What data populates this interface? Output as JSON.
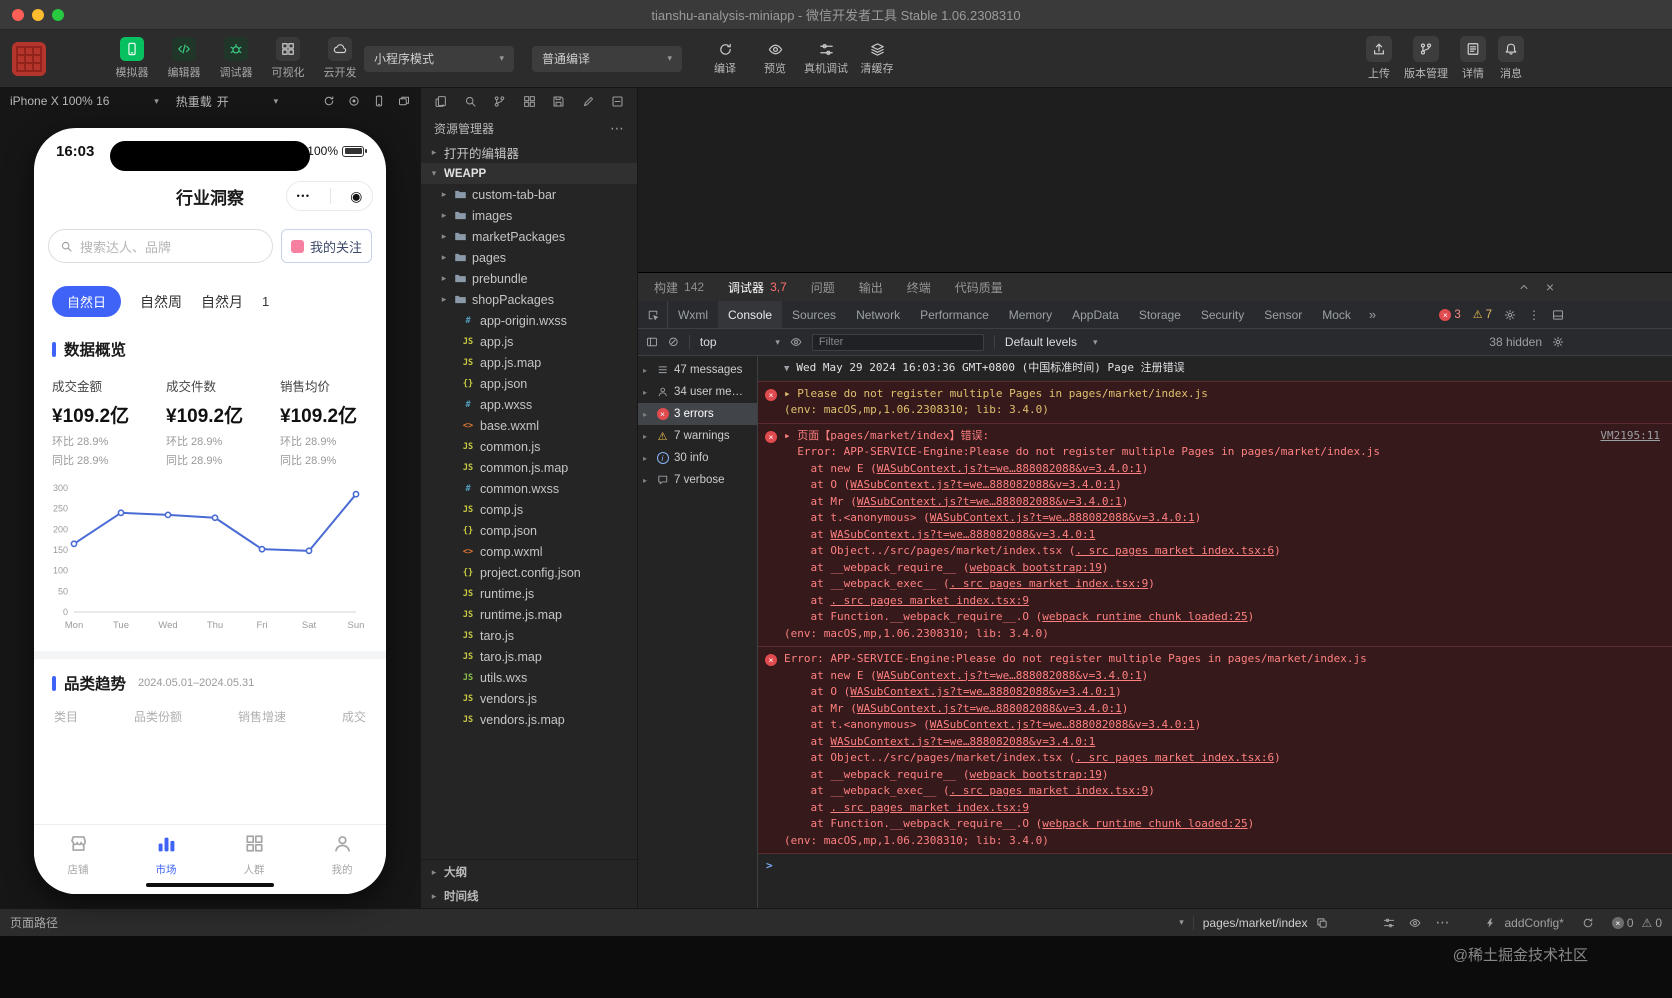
{
  "titlebar": {
    "title": "tianshu-analysis-miniapp - 微信开发者工具 Stable 1.06.2308310"
  },
  "toolbar": {
    "mode_buttons": [
      {
        "label": "模拟器",
        "icon": "simulator-icon",
        "style": "green-fill"
      },
      {
        "label": "编辑器",
        "icon": "editor-icon",
        "style": "green"
      },
      {
        "label": "调试器",
        "icon": "debugger-icon",
        "style": "green"
      },
      {
        "label": "可视化",
        "icon": "visual-icon",
        "style": "plain"
      },
      {
        "label": "云开发",
        "icon": "cloud-icon",
        "style": "plain"
      }
    ],
    "mode_select": "小程序模式",
    "compile_select": "普通编译",
    "action_buttons": [
      {
        "label": "编译",
        "icon": "compile-icon"
      },
      {
        "label": "预览",
        "icon": "preview-icon"
      },
      {
        "label": "真机调试",
        "icon": "device-debug-icon"
      },
      {
        "label": "清缓存",
        "icon": "clear-cache-icon"
      }
    ],
    "right_buttons": [
      {
        "label": "上传",
        "icon": "upload-icon"
      },
      {
        "label": "版本管理",
        "icon": "version-icon"
      },
      {
        "label": "详情",
        "icon": "details-icon"
      },
      {
        "label": "消息",
        "icon": "message-icon"
      }
    ],
    "wechat_green": "#07c160"
  },
  "simulator_bar": {
    "device": "iPhone X 100% 16",
    "hot_reload_label": "热重载",
    "hot_reload_state": "开"
  },
  "phone": {
    "accent": "#3e63f6",
    "time": "16:03",
    "battery": "100%",
    "nav_title": "行业洞察",
    "search_placeholder": "搜索达人、品牌",
    "follow_button": "我的关注",
    "date_tabs": [
      {
        "label": "自然日",
        "active": true
      },
      {
        "label": "自然周",
        "active": false
      },
      {
        "label": "自然月",
        "active": false
      }
    ],
    "tab_badge": "1",
    "overview_title": "数据概览",
    "metrics": [
      {
        "label": "成交金额",
        "value": "¥109.2亿",
        "mom": "环比 28.9%",
        "yoy": "同比 28.9%"
      },
      {
        "label": "成交件数",
        "value": "¥109.2亿",
        "mom": "环比 28.9%",
        "yoy": "同比 28.9%"
      },
      {
        "label": "销售均价",
        "value": "¥109.2亿",
        "mom": "环比 28.9%",
        "yoy": "同比 28.9%"
      }
    ],
    "trend_title": "品类趋势",
    "trend_date": "2024.05.01–2024.05.31",
    "table_headers": [
      "类目",
      "品类份额",
      "销售增速",
      "成交"
    ],
    "tabbar": [
      {
        "label": "店铺",
        "icon": "shop-icon",
        "active": false
      },
      {
        "label": "市场",
        "icon": "market-icon",
        "active": true
      },
      {
        "label": "人群",
        "icon": "crowd-icon",
        "active": false
      },
      {
        "label": "我的",
        "icon": "mine-icon",
        "active": false
      }
    ]
  },
  "chart_data": {
    "type": "line",
    "title": "数据概览趋势",
    "x": [
      "Mon",
      "Tue",
      "Wed",
      "Thu",
      "Fri",
      "Sat",
      "Sun"
    ],
    "values": [
      165,
      240,
      235,
      228,
      152,
      148,
      285
    ],
    "ylim": [
      0,
      300
    ],
    "yticks": [
      0,
      50,
      100,
      150,
      200,
      250,
      300
    ],
    "grid": false,
    "legend": "none",
    "line_color": "#4a6bd5"
  },
  "explorer": {
    "title": "资源管理器",
    "open_editors": "打开的编辑器",
    "root": "WEAPP",
    "folders": [
      "custom-tab-bar",
      "images",
      "marketPackages",
      "pages",
      "prebundle",
      "shopPackages"
    ],
    "files": [
      "app-origin.wxss",
      "app.js",
      "app.js.map",
      "app.json",
      "app.wxss",
      "base.wxml",
      "common.js",
      "common.js.map",
      "common.wxss",
      "comp.js",
      "comp.json",
      "comp.wxml",
      "project.config.json",
      "runtime.js",
      "runtime.js.map",
      "taro.js",
      "taro.js.map",
      "utils.wxs",
      "vendors.js",
      "vendors.js.map"
    ],
    "bottom_sections": [
      "大纲",
      "时间线"
    ]
  },
  "debugger": {
    "panel_tabs": [
      {
        "label": "构建",
        "badge": "142",
        "badge_type": "count",
        "active": false
      },
      {
        "label": "调试器",
        "badge": "3,7",
        "badge_type": "error",
        "active": true
      },
      {
        "label": "问题",
        "active": false
      },
      {
        "label": "输出",
        "active": false
      },
      {
        "label": "终端",
        "active": false
      },
      {
        "label": "代码质量",
        "active": false
      }
    ],
    "devtools_tabs": [
      {
        "label": "Wxml",
        "active": false
      },
      {
        "label": "Console",
        "active": true
      },
      {
        "label": "Sources",
        "active": false
      },
      {
        "label": "Network",
        "active": false
      },
      {
        "label": "Performance",
        "active": false
      },
      {
        "label": "Memory",
        "active": false
      },
      {
        "label": "AppData",
        "active": false
      },
      {
        "label": "Storage",
        "active": false
      },
      {
        "label": "Security",
        "active": false
      },
      {
        "label": "Sensor",
        "active": false
      },
      {
        "label": "Mock",
        "active": false
      }
    ],
    "error_badge": "3",
    "warning_badge": "7",
    "console": {
      "context": "top",
      "filter_placeholder": "Filter",
      "levels": "Default levels",
      "hidden_label": "38 hidden",
      "prompt": ">",
      "sidebar": [
        {
          "label": "47 messages",
          "icon": "list-icon",
          "active": false
        },
        {
          "label": "34 user me…",
          "icon": "person-icon",
          "active": false
        },
        {
          "label": "3 errors",
          "icon": "error-icon",
          "active": true
        },
        {
          "label": "7 warnings",
          "icon": "warning-icon",
          "active": false
        },
        {
          "label": "30 info",
          "icon": "info-icon",
          "active": false
        },
        {
          "label": "7 verbose",
          "icon": "verbose-icon",
          "active": false
        }
      ],
      "messages": [
        {
          "kind": "log",
          "arrow": "▼",
          "text": "Wed May 29 2024 16:03:36 GMT+0800 (中国标准时间) Page 注册错误"
        },
        {
          "kind": "error",
          "tone": "yellow",
          "lines": [
            [
              {
                "t": "▸ Please do not register multiple Pages in pages/market/index.js"
              }
            ],
            [
              {
                "t": "(env: macOS,mp,1.06.2308310; lib: 3.4.0)"
              }
            ]
          ]
        },
        {
          "kind": "error",
          "source": "VM2195:11",
          "lines": [
            [
              {
                "t": "▸ 页面【pages/market/index】错误:"
              }
            ],
            [
              {
                "t": "  Error: APP-SERVICE-Engine:Please do not register multiple Pages in pages/market/index.js"
              }
            ],
            [
              {
                "t": "    at new E ("
              },
              {
                "l": "WASubContext.js?t=we…888082088&v=3.4.0:1"
              },
              {
                "t": ")"
              }
            ],
            [
              {
                "t": "    at O ("
              },
              {
                "l": "WASubContext.js?t=we…888082088&v=3.4.0:1"
              },
              {
                "t": ")"
              }
            ],
            [
              {
                "t": "    at Mr ("
              },
              {
                "l": "WASubContext.js?t=we…888082088&v=3.4.0:1"
              },
              {
                "t": ")"
              }
            ],
            [
              {
                "t": "    at t.<anonymous> ("
              },
              {
                "l": "WASubContext.js?t=we…888082088&v=3.4.0:1"
              },
              {
                "t": ")"
              }
            ],
            [
              {
                "t": "    at "
              },
              {
                "l": "WASubContext.js?t=we…888082088&v=3.4.0:1"
              }
            ],
            [
              {
                "t": "    at Object../src/pages/market/index.tsx ("
              },
              {
                "l": ". src pages market index.tsx:6"
              },
              {
                "t": ")"
              }
            ],
            [
              {
                "t": "    at __webpack_require__ ("
              },
              {
                "l": "webpack bootstrap:19"
              },
              {
                "t": ")"
              }
            ],
            [
              {
                "t": "    at __webpack_exec__ ("
              },
              {
                "l": ". src pages market index.tsx:9"
              },
              {
                "t": ")"
              }
            ],
            [
              {
                "t": "    at "
              },
              {
                "l": ". src pages market index.tsx:9"
              }
            ],
            [
              {
                "t": "    at Function.__webpack_require__.O ("
              },
              {
                "l": "webpack runtime chunk loaded:25"
              },
              {
                "t": ")"
              }
            ],
            [
              {
                "t": "(env: macOS,mp,1.06.2308310; lib: 3.4.0)"
              }
            ]
          ]
        },
        {
          "kind": "error",
          "lines": [
            [
              {
                "t": "Error: APP-SERVICE-Engine:Please do not register multiple Pages in pages/market/index.js"
              }
            ],
            [
              {
                "t": "    at new E ("
              },
              {
                "l": "WASubContext.js?t=we…888082088&v=3.4.0:1"
              },
              {
                "t": ")"
              }
            ],
            [
              {
                "t": "    at O ("
              },
              {
                "l": "WASubContext.js?t=we…888082088&v=3.4.0:1"
              },
              {
                "t": ")"
              }
            ],
            [
              {
                "t": "    at Mr ("
              },
              {
                "l": "WASubContext.js?t=we…888082088&v=3.4.0:1"
              },
              {
                "t": ")"
              }
            ],
            [
              {
                "t": "    at t.<anonymous> ("
              },
              {
                "l": "WASubContext.js?t=we…888082088&v=3.4.0:1"
              },
              {
                "t": ")"
              }
            ],
            [
              {
                "t": "    at "
              },
              {
                "l": "WASubContext.js?t=we…888082088&v=3.4.0:1"
              }
            ],
            [
              {
                "t": "    at Object../src/pages/market/index.tsx ("
              },
              {
                "l": ". src pages market index.tsx:6"
              },
              {
                "t": ")"
              }
            ],
            [
              {
                "t": "    at __webpack_require__ ("
              },
              {
                "l": "webpack bootstrap:19"
              },
              {
                "t": ")"
              }
            ],
            [
              {
                "t": "    at __webpack_exec__ ("
              },
              {
                "l": ". src pages market index.tsx:9"
              },
              {
                "t": ")"
              }
            ],
            [
              {
                "t": "    at "
              },
              {
                "l": ". src pages market index.tsx:9"
              }
            ],
            [
              {
                "t": "    at Function.__webpack_require__.O ("
              },
              {
                "l": "webpack runtime chunk loaded:25"
              },
              {
                "t": ")"
              }
            ],
            [
              {
                "t": "(env: macOS,mp,1.06.2308310; lib: 3.4.0)"
              }
            ]
          ]
        }
      ]
    }
  },
  "statusbar": {
    "page_path_label": "页面路径",
    "page_path": "pages/market/index",
    "add_config": "addConfig*",
    "error_count": "0",
    "warning_count": "0"
  },
  "watermark": "@稀土掘金技术社区"
}
